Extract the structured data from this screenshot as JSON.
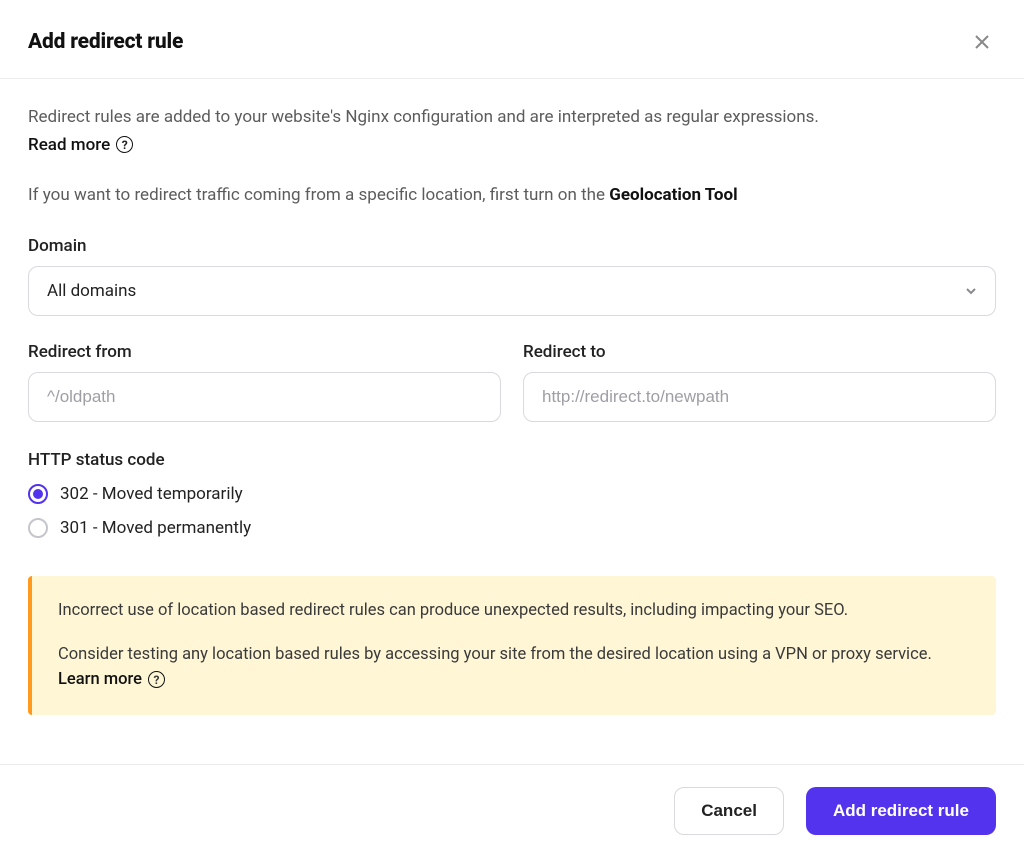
{
  "title": "Add redirect rule",
  "intro": "Redirect rules are added to your website's Nginx configuration and are interpreted as regular expressions.",
  "read_more": "Read more",
  "geo": {
    "prefix": "If you want to redirect traffic coming from a specific location, first turn on the ",
    "tool": "Geolocation Tool"
  },
  "domain": {
    "label": "Domain",
    "selected": "All domains"
  },
  "redirect_from": {
    "label": "Redirect from",
    "placeholder": "^/oldpath",
    "value": ""
  },
  "redirect_to": {
    "label": "Redirect to",
    "placeholder": "http://redirect.to/newpath",
    "value": ""
  },
  "status_code": {
    "label": "HTTP status code",
    "options": [
      {
        "label": "302 - Moved temporarily",
        "value": "302",
        "selected": true
      },
      {
        "label": "301 - Moved permanently",
        "value": "301",
        "selected": false
      }
    ]
  },
  "alert": {
    "p1": "Incorrect use of location based redirect rules can produce unexpected results, including impacting your SEO.",
    "p2_prefix": "Consider testing any location based rules by accessing your site from the desired location using a VPN or proxy service. ",
    "learn_more": "Learn more"
  },
  "footer": {
    "cancel": "Cancel",
    "submit": "Add redirect rule"
  }
}
